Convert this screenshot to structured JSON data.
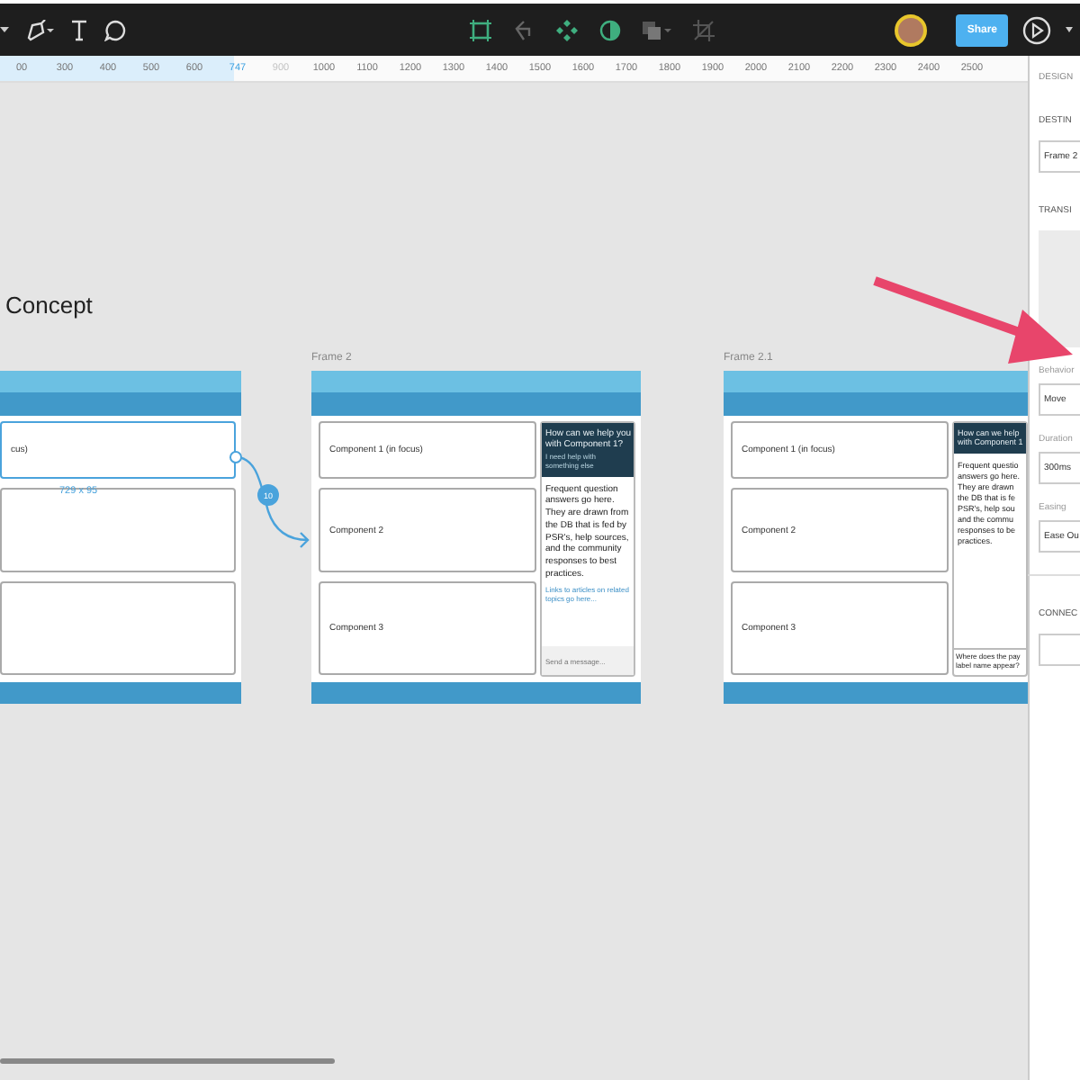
{
  "toolbar": {
    "share": "Share"
  },
  "ruler": {
    "ticks": [
      {
        "label": "00",
        "kind": "plain"
      },
      {
        "label": "300",
        "kind": "plain"
      },
      {
        "label": "400",
        "kind": "plain"
      },
      {
        "label": "500",
        "kind": "plain"
      },
      {
        "label": "600",
        "kind": "plain"
      },
      {
        "label": "747",
        "kind": "marker"
      },
      {
        "label": "900",
        "kind": "faint"
      },
      {
        "label": "1000",
        "kind": "plain"
      },
      {
        "label": "1100",
        "kind": "plain"
      },
      {
        "label": "1200",
        "kind": "plain"
      },
      {
        "label": "1300",
        "kind": "plain"
      },
      {
        "label": "1400",
        "kind": "plain"
      },
      {
        "label": "1500",
        "kind": "plain"
      },
      {
        "label": "1600",
        "kind": "plain"
      },
      {
        "label": "1700",
        "kind": "plain"
      },
      {
        "label": "1800",
        "kind": "plain"
      },
      {
        "label": "1900",
        "kind": "plain"
      },
      {
        "label": "2000",
        "kind": "plain"
      },
      {
        "label": "2100",
        "kind": "plain"
      },
      {
        "label": "2200",
        "kind": "plain"
      },
      {
        "label": "2300",
        "kind": "plain"
      },
      {
        "label": "2400",
        "kind": "plain"
      },
      {
        "label": "2500",
        "kind": "plain"
      }
    ]
  },
  "canvas": {
    "page_title": "Concept",
    "frames": [
      {
        "components": [
          {
            "text": "cus)",
            "selected": true
          },
          {
            "selected": false
          },
          {
            "selected": false
          }
        ],
        "size": "729 x 95",
        "link_badge": "10"
      },
      {
        "label": "Frame 2",
        "components": [
          {
            "text": "Component 1 (in focus)",
            "selected": false
          },
          {
            "text": "Component 2",
            "selected": false
          },
          {
            "text": "Component 3",
            "selected": false
          }
        ],
        "chat": {
          "header_lines": [
            "How can we help you",
            "with Component 1?"
          ],
          "subtext": "I need help with something else",
          "body_lines": [
            "Frequent question",
            "answers go here.",
            "They are drawn from",
            "the DB that is fed by",
            "PSR's, help sources,",
            "and the community",
            "responses to best",
            "practices."
          ],
          "link": "Links to articles on related topics go here...",
          "placeholder": "Send a message..."
        }
      },
      {
        "label": "Frame 2.1",
        "components": [
          {
            "text": "Component 1 (in focus)",
            "selected": false
          },
          {
            "text": "Component 2",
            "selected": false
          },
          {
            "text": "Component 3",
            "selected": false
          }
        ],
        "chat": {
          "header_lines": [
            "How can we help",
            "with Component 1"
          ],
          "body_lines": [
            "Frequent questio",
            "answers go here.",
            "They are drawn",
            "the DB that is fe",
            "PSR's, help sou",
            "and the commu",
            "responses to be",
            "practices."
          ],
          "question_lines": [
            "Where does the pay",
            "label name appear?"
          ]
        }
      }
    ]
  },
  "panel": {
    "tab": "DESIGN",
    "destination_heading": "DESTIN",
    "destination": "Frame 2",
    "transition_heading": "TRANSI",
    "fields": [
      {
        "label": "Behavior",
        "value": "Move"
      },
      {
        "label": "Duration",
        "value": "300ms"
      },
      {
        "label": "Easing",
        "value": "Ease Ou"
      }
    ],
    "connection_heading": "CONNEC"
  }
}
